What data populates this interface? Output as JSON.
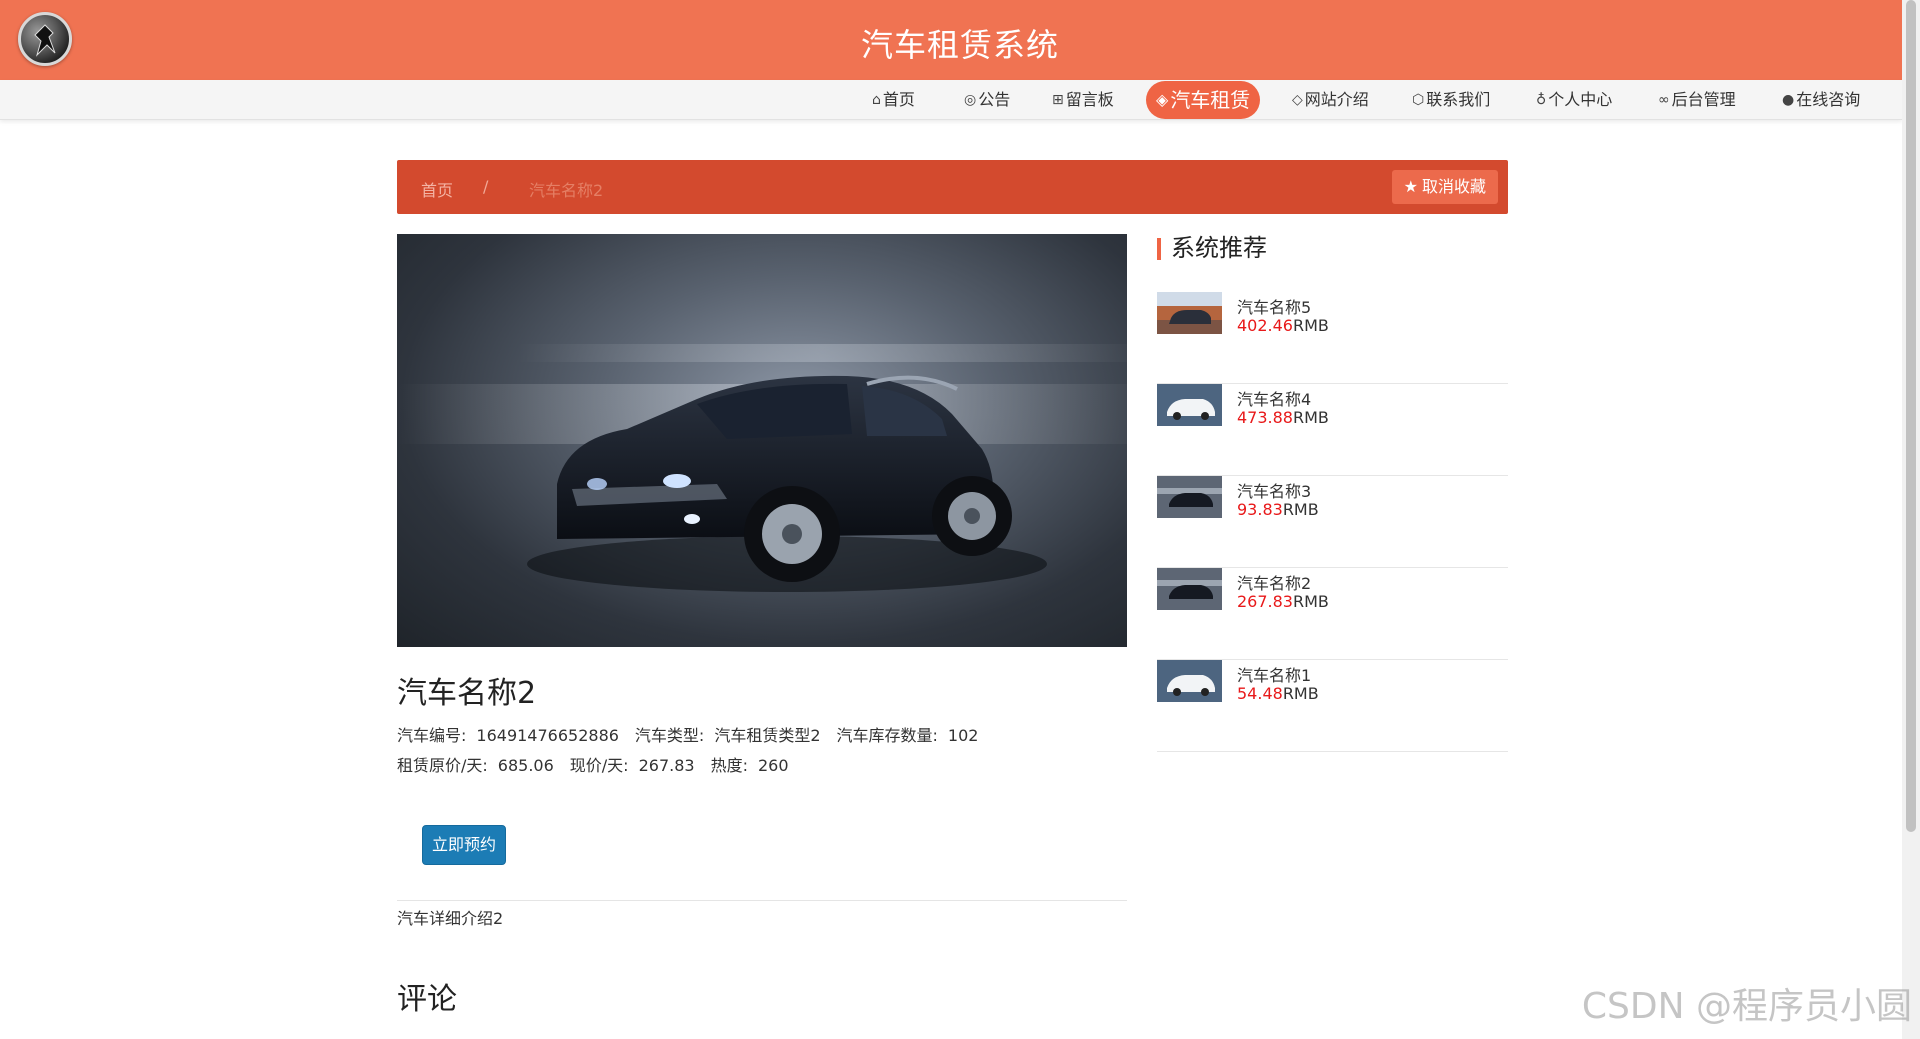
{
  "header": {
    "title": "汽车租赁系统"
  },
  "nav": {
    "items": [
      {
        "label": "首页",
        "icon": "home-icon",
        "glyph": "⌂"
      },
      {
        "label": "公告",
        "icon": "bulletin-icon",
        "glyph": "◎"
      },
      {
        "label": "留言板",
        "icon": "message-board-icon",
        "glyph": "⊞"
      },
      {
        "label": "汽车租赁",
        "icon": "car-rental-icon",
        "glyph": "◈"
      },
      {
        "label": "网站介绍",
        "icon": "tag-icon",
        "glyph": "◇"
      },
      {
        "label": "联系我们",
        "icon": "contact-icon",
        "glyph": "⬡"
      },
      {
        "label": "个人中心",
        "icon": "user-icon",
        "glyph": "♁"
      },
      {
        "label": "后台管理",
        "icon": "link-icon",
        "glyph": "∞"
      },
      {
        "label": "在线咨询",
        "icon": "chat-icon",
        "glyph": "●"
      }
    ],
    "active_index": 3,
    "accent_color": "#ef6444"
  },
  "breadcrumb": {
    "home": "首页",
    "separator": "/",
    "current": "汽车名称2",
    "favorite_button": "取消收藏"
  },
  "car": {
    "name": "汽车名称2",
    "code_label": "汽车编号:",
    "code": "16491476652886",
    "type_label": "汽车类型:",
    "type": "汽车租赁类型2",
    "stock_label": "汽车库存数量:",
    "stock": "102",
    "orig_price_label": "租赁原价/天:",
    "orig_price": "685.06",
    "price_label": "现价/天:",
    "price": "267.83",
    "heat_label": "热度:",
    "heat": "260",
    "book_button": "立即预约",
    "detail": "汽车详细介绍2"
  },
  "comments": {
    "title": "评论"
  },
  "sidebar": {
    "title": "系统推荐",
    "unit": "RMB",
    "items": [
      {
        "name": "汽车名称5",
        "price": "402.46"
      },
      {
        "name": "汽车名称4",
        "price": "473.88"
      },
      {
        "name": "汽车名称3",
        "price": "93.83"
      },
      {
        "name": "汽车名称2",
        "price": "267.83"
      },
      {
        "name": "汽车名称1",
        "price": "54.48"
      }
    ]
  },
  "watermark": "CSDN @程序员小圆"
}
